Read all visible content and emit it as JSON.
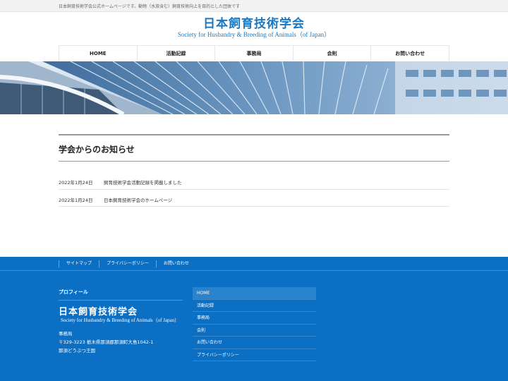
{
  "site": {
    "tagline": "日本飼育技術学会公式ホームページです。動物（水族含む）飼育技術向上を目的とした団体です",
    "logo_jp": "日本飼育技術学会",
    "logo_en": "Society for Husbandry & Breeding of Animals（of Japan）"
  },
  "global_nav": [
    "HOME",
    "活動記録",
    "事務局",
    "会則",
    "お問い合わせ"
  ],
  "main": {
    "section_title": "学会からのお知らせ",
    "news": [
      {
        "date": "2022年1月24日",
        "title": "飼育技術学会活動記録を掲載しました"
      },
      {
        "date": "2022年1月24日",
        "title": "日本飼育技術学会のホームページ"
      }
    ]
  },
  "footer": {
    "nav": [
      "サイトマップ",
      "プライバシーポリシー",
      "お問い合わせ"
    ],
    "profile_heading": "プロフィール",
    "logo_jp": "日本飼育技術学会",
    "logo_en": "Society for Husbandry & Breeding of Animals（of Japan）",
    "address_lines": [
      "事務局",
      "〒329-3223 栃木県那須郡那須町大島1042-1",
      "那須どうぶつ王国"
    ],
    "menu": [
      "HOME",
      "活動記録",
      "事務局",
      "会則",
      "お問い合わせ",
      "プライバシーポリシー"
    ],
    "accent_color": "#0b6fc4"
  }
}
